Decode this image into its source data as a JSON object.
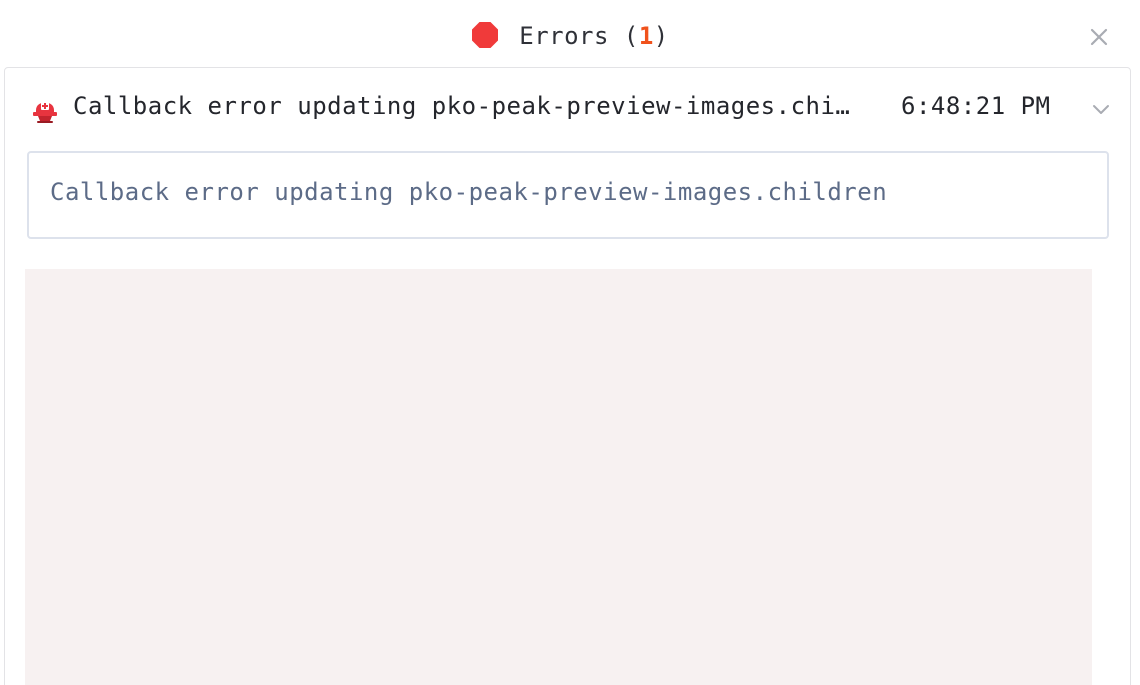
{
  "header": {
    "icon": "stop-sign-icon",
    "title_prefix": "Errors (",
    "count": "1",
    "title_suffix": ")",
    "close_icon": "close-icon",
    "count_color": "#f0521c",
    "stop_color": "#f03a3a"
  },
  "error": {
    "icon": "siren-icon",
    "title": "Callback error updating pko-peak-preview-images.children",
    "timestamp": "6:48:21 PM",
    "toggle_icon": "chevron-down-icon",
    "message": "Callback error updating pko-peak-preview-images.children"
  }
}
